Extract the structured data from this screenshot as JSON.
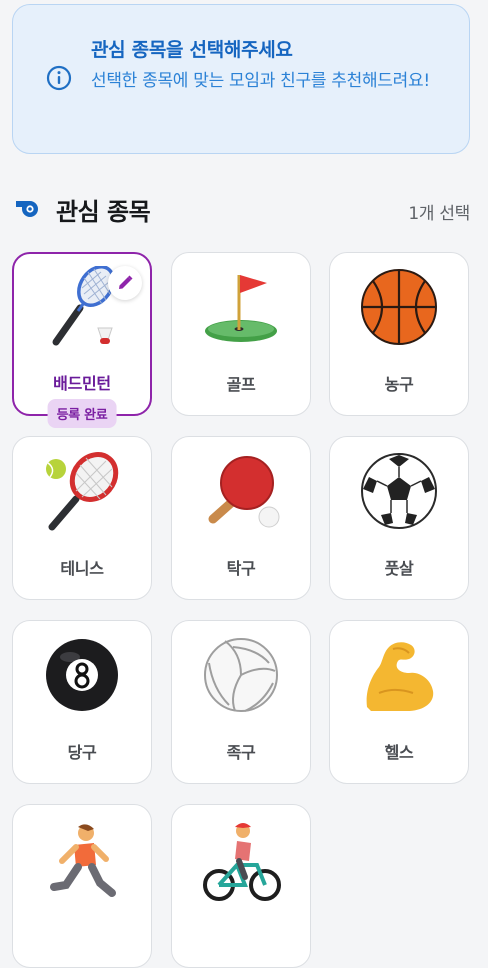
{
  "banner": {
    "title": "관심 종목을 선택해주세요",
    "description": "선택한 종목에 맞는 모임과 친구를 추천해드려요!",
    "icon": "info-icon",
    "accent_color": "#1565c0"
  },
  "section": {
    "title": "관심 종목",
    "count_text": "1개 선택",
    "icon": "whistle-icon"
  },
  "sports": [
    {
      "label": "배드민턴",
      "icon": "badminton-icon",
      "selected": true,
      "status": "등록 완료"
    },
    {
      "label": "골프",
      "icon": "golf-icon",
      "selected": false
    },
    {
      "label": "농구",
      "icon": "basketball-icon",
      "selected": false
    },
    {
      "label": "테니스",
      "icon": "tennis-icon",
      "selected": false
    },
    {
      "label": "탁구",
      "icon": "ping-pong-icon",
      "selected": false
    },
    {
      "label": "풋살",
      "icon": "soccer-ball-icon",
      "selected": false
    },
    {
      "label": "당구",
      "icon": "billiards-8-ball-icon",
      "selected": false
    },
    {
      "label": "족구",
      "icon": "volleyball-icon",
      "selected": false
    },
    {
      "label": "헬스",
      "icon": "flexed-biceps-icon",
      "selected": false
    },
    {
      "label": "",
      "icon": "runner-icon",
      "selected": false
    },
    {
      "label": "",
      "icon": "cyclist-icon",
      "selected": false
    }
  ],
  "colors": {
    "selected_border": "#8e24aa",
    "selected_label": "#6a1b9a",
    "badge_bg": "#ead4f4"
  }
}
